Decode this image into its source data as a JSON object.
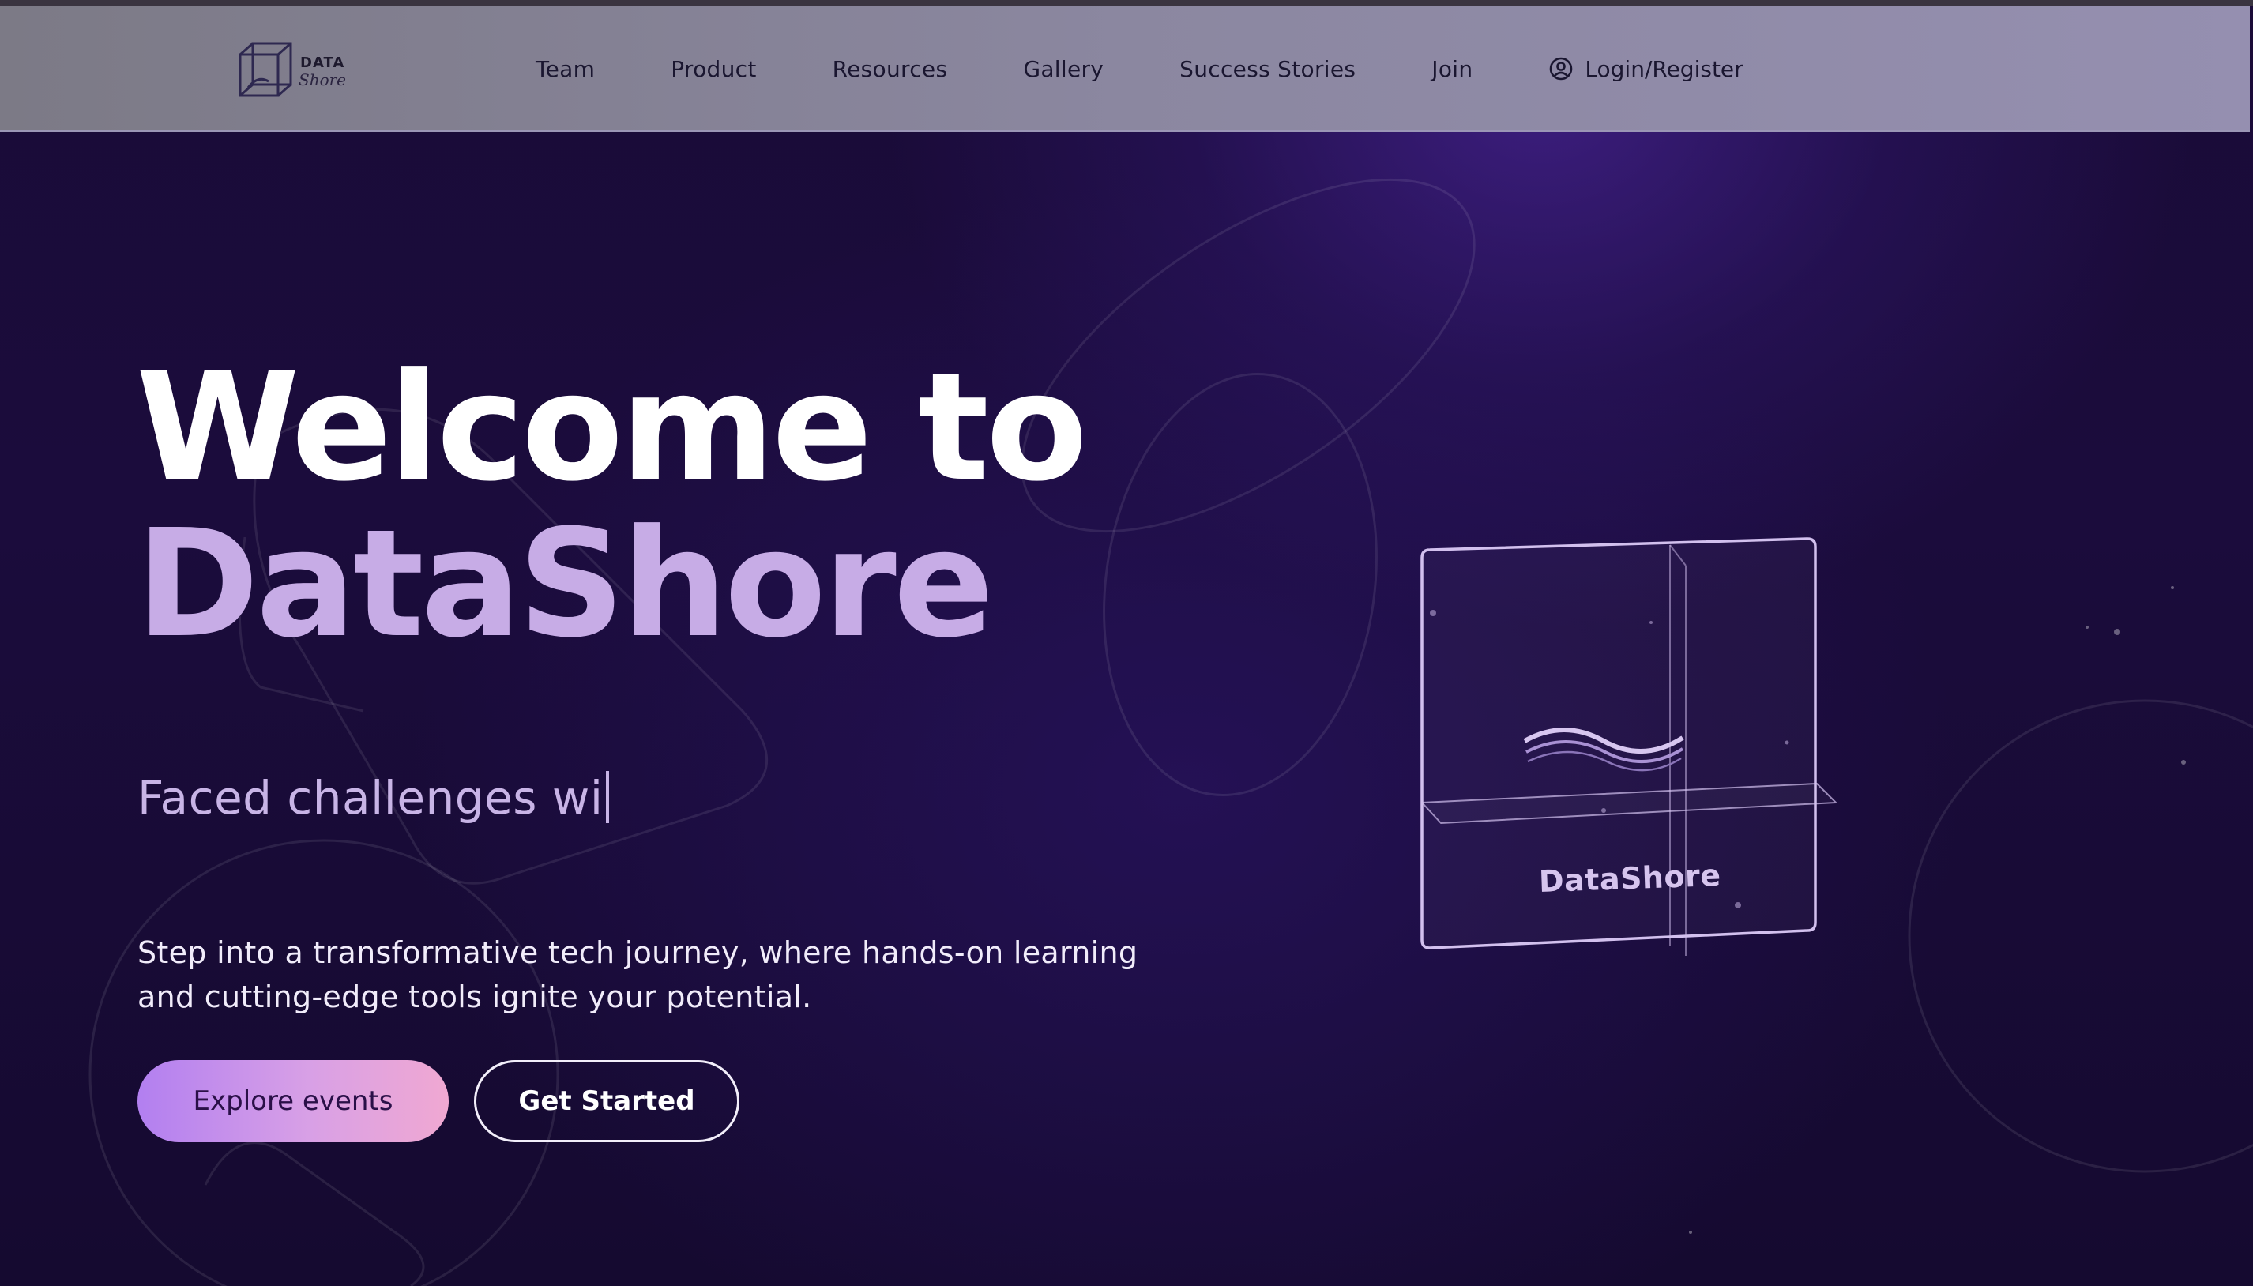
{
  "brand": {
    "logo_word": "DATA",
    "logo_script": "Shore"
  },
  "nav": {
    "links": [
      "Team",
      "Product",
      "Resources",
      "Gallery",
      "Success Stories",
      "Join"
    ],
    "login_label": "Login/Register"
  },
  "hero": {
    "line1": "Welcome to",
    "line2": "DataShore",
    "typing_text": "Faced challenges wi",
    "lead": "Step into a transformative tech journey, where hands-on learning and cutting-edge tools ignite your potential.",
    "primary_cta": "Explore events",
    "secondary_cta": "Get Started"
  },
  "card": {
    "label": "DataShore"
  },
  "colors": {
    "background": "#16092e",
    "navbar": "#8b87a0",
    "accent_lavender": "#c7ace6",
    "cta_gradient_start": "#b27ff0",
    "cta_gradient_end": "#f0a8d2"
  },
  "icons": {
    "logo": "wireframe-cube-icon",
    "login": "user-circle-icon",
    "card_symbol": "wave-icon"
  }
}
